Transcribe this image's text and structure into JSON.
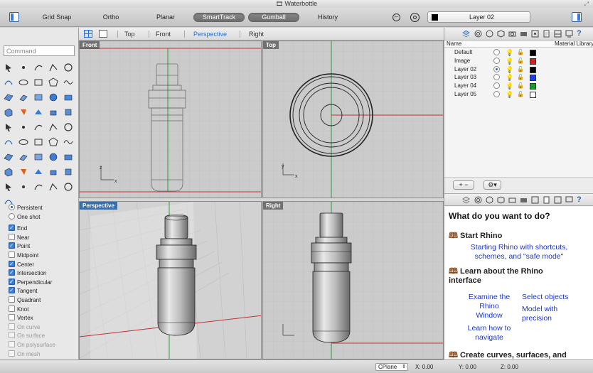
{
  "window": {
    "title": "Waterbottle"
  },
  "toolbar": {
    "grid_snap": "Grid Snap",
    "ortho": "Ortho",
    "planar": "Planar",
    "smarttrack": "SmartTrack",
    "gumball": "Gumball",
    "history": "History",
    "layer": "Layer 02"
  },
  "command": {
    "placeholder": "Command"
  },
  "viewport_tabs": [
    "Top",
    "Front",
    "Perspective",
    "Right"
  ],
  "viewports": {
    "front": "Front",
    "top": "Top",
    "perspective": "Perspective",
    "right": "Right"
  },
  "osnap": {
    "modes": [
      {
        "label": "Persistent",
        "on": true
      },
      {
        "label": "One shot",
        "on": false
      }
    ],
    "items": [
      {
        "label": "End",
        "on": true
      },
      {
        "label": "Near",
        "on": false
      },
      {
        "label": "Point",
        "on": true
      },
      {
        "label": "Midpoint",
        "on": false
      },
      {
        "label": "Center",
        "on": true
      },
      {
        "label": "Intersection",
        "on": true
      },
      {
        "label": "Perpendicular",
        "on": true
      },
      {
        "label": "Tangent",
        "on": true
      },
      {
        "label": "Quadrant",
        "on": false
      },
      {
        "label": "Knot",
        "on": false
      },
      {
        "label": "Vertex",
        "on": false
      }
    ],
    "dim_items": [
      {
        "label": "On curve"
      },
      {
        "label": "On surface"
      },
      {
        "label": "On polysurface"
      },
      {
        "label": "On mesh"
      }
    ]
  },
  "layers": {
    "header_name": "Name",
    "header_material": "Material Library",
    "rows": [
      {
        "name": "Default",
        "color": "#000000",
        "current": false
      },
      {
        "name": "Image",
        "color": "#d42020",
        "current": false
      },
      {
        "name": "Layer 02",
        "color": "#000000",
        "current": true
      },
      {
        "name": "Layer 03",
        "color": "#1f3fe0",
        "current": false
      },
      {
        "name": "Layer 04",
        "color": "#1a9a2a",
        "current": false
      },
      {
        "name": "Layer 05",
        "color": "#ffffff",
        "current": false
      }
    ]
  },
  "help": {
    "question": "What do you want to do?",
    "s1_title": "Start Rhino",
    "s1_link1": "Starting Rhino with shortcuts,",
    "s1_link2": "schemes, and \"safe mode\"",
    "s2_title1": "Learn about the Rhino",
    "s2_title2": "interface",
    "s2_l1a": "Examine the",
    "s2_l1b": "Rhino",
    "s2_l1c": "Window",
    "s2_l2": "Select objects",
    "s2_l3a": "Model with",
    "s2_l3b": "precision",
    "s2_l4a": "Learn how to",
    "s2_l4b": "navigate",
    "s3_title": "Create curves, surfaces, and"
  },
  "status": {
    "cplane": "CPlane",
    "x": "X: 0.00",
    "y": "Y: 0.00",
    "z": "Z: 0.00"
  }
}
